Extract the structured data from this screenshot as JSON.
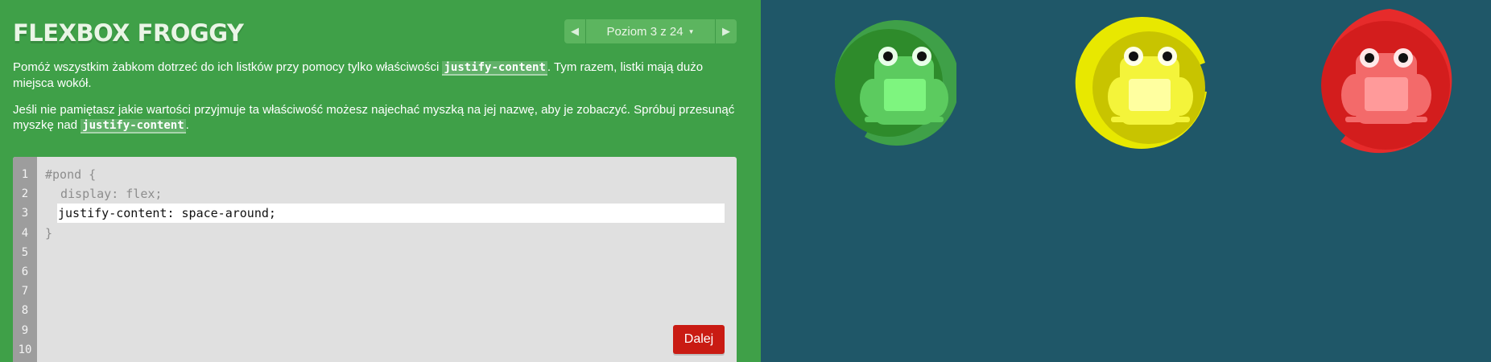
{
  "header": {
    "title": "FLEXBOX FROGGY",
    "level_label": "Poziom 3 z 24"
  },
  "instructions": {
    "p1_before": "Pomóż wszystkim żabkom dotrzeć do ich listków przy pomocy tylko właściwości ",
    "p1_code": "justify-content",
    "p1_after": ". Tym razem, listki mają dużo miejsca wokół.",
    "p2_before": "Jeśli nie pamiętasz jakie wartości przyjmuje ta właściwość możesz najechać myszką na jej nazwę, aby je zobaczyć. Spróbuj przesunąć myszkę nad ",
    "p2_code": "justify-content",
    "p2_after": "."
  },
  "editor": {
    "line_numbers": [
      "1",
      "2",
      "3",
      "4",
      "5",
      "6",
      "7",
      "8",
      "9",
      "10"
    ],
    "line1": "#pond {",
    "line2": "display: flex;",
    "input_value": "justify-content: space-around;",
    "line4": "}",
    "next_label": "Dalej"
  },
  "pond": {
    "background": "#1f5768",
    "frogs": [
      {
        "color": "green",
        "pad_color": "#2e8b2b",
        "body_color": "#5ccb5f"
      },
      {
        "color": "yellow",
        "pad_color": "#d8d800",
        "body_color": "#f4f43a"
      },
      {
        "color": "red",
        "pad_color": "#d31d1d",
        "body_color": "#f36a6a"
      }
    ]
  },
  "colors": {
    "sidebar": "#3fa048",
    "next_button": "#c91b13"
  }
}
